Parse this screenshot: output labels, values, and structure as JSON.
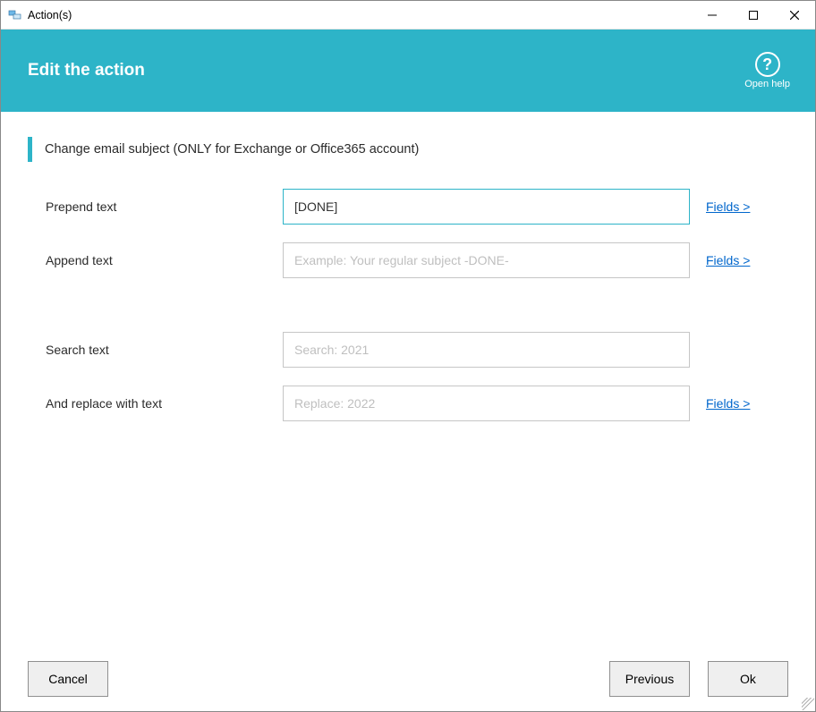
{
  "window": {
    "title": "Action(s)"
  },
  "header": {
    "title": "Edit the action",
    "help_label": "Open help"
  },
  "section": {
    "heading": "Change email subject (ONLY for Exchange or Office365 account)"
  },
  "form": {
    "prepend_label": "Prepend text",
    "prepend_value": "[DONE]",
    "append_label": "Append text",
    "append_placeholder": "Example: Your regular subject -DONE-",
    "search_label": "Search text",
    "search_placeholder": "Search: 2021",
    "replace_label": "And replace with text",
    "replace_placeholder": "Replace: 2022",
    "fields_link": "Fields >"
  },
  "footer": {
    "cancel": "Cancel",
    "previous": "Previous",
    "ok": "Ok"
  }
}
